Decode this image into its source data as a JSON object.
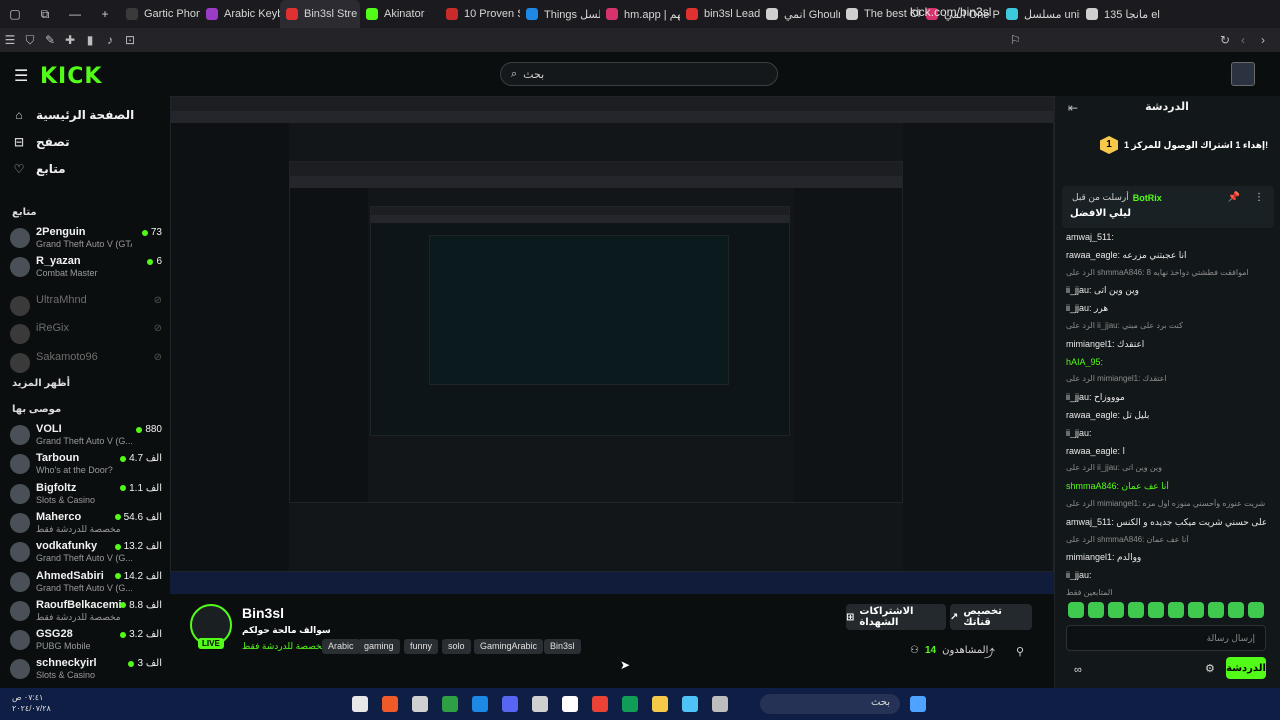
{
  "browser": {
    "tabs": [
      {
        "label": "Gartic Phone",
        "color": "#3a3a3a"
      },
      {
        "label": "Arabic Keyboa",
        "color": "#9b3cc7"
      },
      {
        "label": "Bin3sl Stre",
        "color": "#e03131",
        "active": true
      },
      {
        "label": "Akinator",
        "color": "#53fc18"
      },
      {
        "label": "10 Proven Strat",
        "color": "#c92a2a"
      },
      {
        "label": "Things مسلسل",
        "color": "#1e88e5"
      },
      {
        "label": "hm.app | لعبهم",
        "color": "#d6336c"
      },
      {
        "label": "bin3sl Leaderb",
        "color": "#e03131"
      },
      {
        "label": "انمي Ghoulre",
        "color": "#cfcfcf"
      },
      {
        "label": "The best ChatB",
        "color": "#cfcfcf"
      },
      {
        "label": "انمي One Piece",
        "color": "#d6336c"
      },
      {
        "label": "مسلسل unisher",
        "color": "#3bc9db"
      },
      {
        "label": "مانجا 135 eling",
        "color": "#cfcfcf"
      }
    ],
    "url": "kick.com/bin3sl"
  },
  "header": {
    "logo": "KICK",
    "search_placeholder": "بحث"
  },
  "sidebar": {
    "nav": [
      {
        "label": "الصفحة الرئيسية",
        "icon": "home-icon"
      },
      {
        "label": "تصفح",
        "icon": "browse-icon"
      },
      {
        "label": "متابع",
        "icon": "heart-icon"
      }
    ],
    "following_header": "متابع",
    "following": [
      {
        "name": "2Penguin",
        "category": "Grand Theft Auto V (GTA)",
        "viewers": "73",
        "live": true
      },
      {
        "name": "R_yazan",
        "category": "Combat Master",
        "viewers": "6",
        "live": true
      },
      {
        "name": "UltraMhnd",
        "category": "",
        "viewers": "",
        "live": false
      },
      {
        "name": "iReGix",
        "category": "",
        "viewers": "",
        "live": false
      },
      {
        "name": "Sakamoto96",
        "category": "",
        "viewers": "",
        "live": false
      }
    ],
    "show_more": "أظهر المزيد",
    "recommended_header": "موصى بها",
    "recommended": [
      {
        "name": "VOLI",
        "category": "Grand Theft Auto V (G...",
        "viewers": "880"
      },
      {
        "name": "Tarboun",
        "category": "Who's at the Door?",
        "viewers": "4.7 الف"
      },
      {
        "name": "Bigfoltz",
        "category": "Slots & Casino",
        "viewers": "1.1 الف"
      },
      {
        "name": "Maherco",
        "category": "مخصصة للدردشة فقط",
        "viewers": "54.6 الف"
      },
      {
        "name": "vodkafunky",
        "category": "Grand Theft Auto V (G...",
        "viewers": "13.2 الف"
      },
      {
        "name": "AhmedSabiri",
        "category": "Grand Theft Auto V (G...",
        "viewers": "14.2 الف"
      },
      {
        "name": "RaoufBelkacemi",
        "category": "مخصصة للدردشة فقط",
        "viewers": "8.8 الف"
      },
      {
        "name": "GSG28",
        "category": "PUBG Mobile",
        "viewers": "3.2 الف"
      },
      {
        "name": "schneckyirl",
        "category": "Slots & Casino",
        "viewers": "3 الف"
      }
    ]
  },
  "stream": {
    "name": "Bin3sl",
    "title": "سوالف مالحة حولكم",
    "category": "مخصصة للدردشة فقط",
    "live_badge": "LIVE",
    "tags": [
      "Arabic",
      "gaming",
      "funny",
      "solo",
      "GamingArabic",
      "Bin3sl"
    ],
    "customize_button": "تخصيص قناتك",
    "subscriptions_button": "الاشتراكات الشهداة",
    "viewers_label": "المشاهدون",
    "viewers_count": "14"
  },
  "chat": {
    "title": "الدردشة",
    "gift_text": "إهداء 1 اشتراك الوصول للمركز 1!",
    "gift_rank": "1",
    "pinned": {
      "prefix": "أرسلت من قبل",
      "user": "BotRix",
      "message": "ليلي الافضل"
    },
    "messages": [
      {
        "text": "amwaj_511:",
        "reply": false,
        "color": "#e8e8e8"
      },
      {
        "text": "rawaa_eagle: انا عجبتني مزرعه",
        "reply": false,
        "color": "#e8e8e8"
      },
      {
        "text": "الرد على shmmaA846: اموافقت فطشتي دواخذ نهايه 8",
        "reply": true,
        "color": "#8c8c8c"
      },
      {
        "text": "ii_jjau: وين وين اتى",
        "reply": false,
        "color": "#e8e8e8"
      },
      {
        "text": "ii_jjau: هرر",
        "reply": false,
        "color": "#e8e8e8"
      },
      {
        "text": "الرد على ii_jjau: كنت برد على مبني",
        "reply": true,
        "color": "#8c8c8c"
      },
      {
        "text": "mimiangel1: اعتقدك",
        "reply": false,
        "color": "#e8e8e8"
      },
      {
        "text": "hAIA_95:",
        "reply": false,
        "color": "#53fc18"
      },
      {
        "text": "الرد على mimiangel1: اعتقدك",
        "reply": true,
        "color": "#8c8c8c"
      },
      {
        "text": "ii_jjau: موووزاح",
        "reply": false,
        "color": "#e8e8e8"
      },
      {
        "text": "rawaa_eagle: بليل تل",
        "reply": false,
        "color": "#e8e8e8"
      },
      {
        "text": "ii_jjau:",
        "reply": false,
        "color": "#e8e8e8"
      },
      {
        "text": "rawaa_eagle: ا",
        "reply": false,
        "color": "#e8e8e8"
      },
      {
        "text": "الرد على ii_jjau: وين وين اتى",
        "reply": true,
        "color": "#8c8c8c"
      },
      {
        "text": "shmmaA846: أنا عف عمان",
        "reply": false,
        "color": "#53fc18"
      },
      {
        "text": "الرد على mimiangel1: شريت عنوزه وأحسني منوزه اول مزه",
        "reply": true,
        "color": "#8c8c8c"
      },
      {
        "text": "amwaj_511: عنو على حسني شريت ميكب جديده و الكنس",
        "reply": false,
        "color": "#e8e8e8"
      },
      {
        "text": "الرد على shmmaA846: أنا عف عمان",
        "reply": true,
        "color": "#8c8c8c"
      },
      {
        "text": "mimiangel1: ووالدم",
        "reply": false,
        "color": "#e8e8e8"
      },
      {
        "text": "ii_jjau:",
        "reply": false,
        "color": "#e8e8e8"
      },
      {
        "text": "المتابعين فقط",
        "reply": true,
        "color": "#8c8c8c"
      }
    ],
    "input_placeholder": "إرسال رسالة",
    "send_label": "الدردشة"
  },
  "os": {
    "clock_time": "٠٧:٤١ ص",
    "clock_date": "٢٠٢٤/٠٧/٢٨",
    "search": "بحث"
  }
}
